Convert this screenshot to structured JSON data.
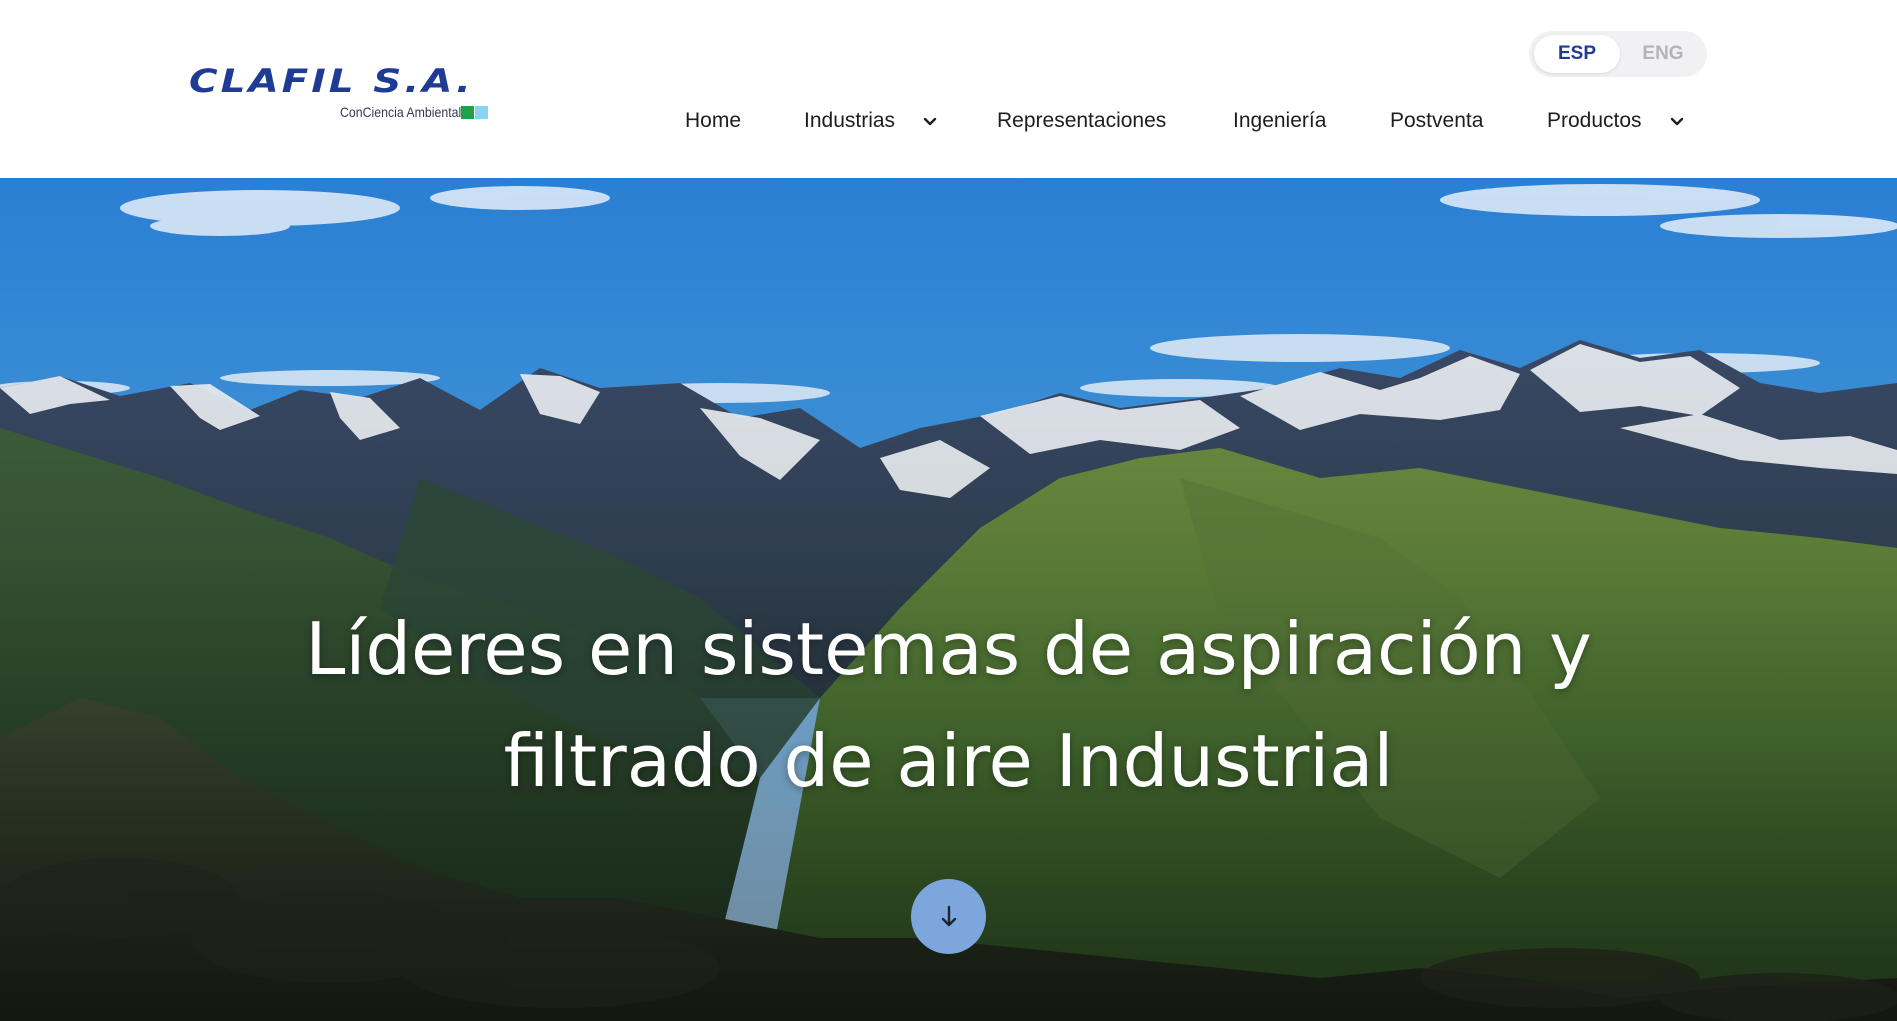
{
  "brand": {
    "name": "CLAFIL S.A.",
    "tagline": "ConCiencia Ambiental",
    "colors": {
      "primary": "#1f3b94",
      "green": "#1aa34a",
      "lightblue": "#87d3f2"
    }
  },
  "language": {
    "active": "ESP",
    "inactive": "ENG"
  },
  "nav": {
    "items": [
      {
        "label": "Home",
        "has_dropdown": false
      },
      {
        "label": "Industrias",
        "has_dropdown": true,
        "icon": "chevron-down-icon"
      },
      {
        "label": "Representaciones",
        "has_dropdown": false
      },
      {
        "label": "Ingeniería",
        "has_dropdown": false
      },
      {
        "label": "Postventa",
        "has_dropdown": false
      },
      {
        "label": "Productos",
        "has_dropdown": true,
        "icon": "chevron-down-icon"
      }
    ]
  },
  "hero": {
    "headline_line1": "Líderes en sistemas de aspiración y",
    "headline_line2": "filtrado de aire Industrial",
    "scroll_icon": "arrow-down-icon",
    "scroll_color": "#7da7dc"
  }
}
